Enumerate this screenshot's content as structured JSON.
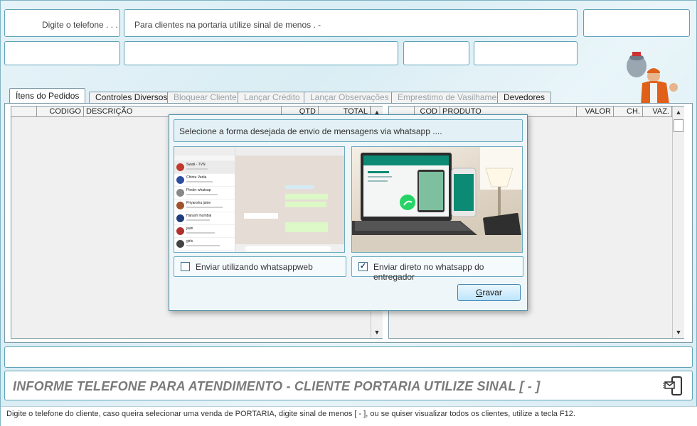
{
  "top_fields": {
    "phone_placeholder": "Digite o telefone . . .",
    "portaria_hint": "Para clientes na portaria utilize sinal de menos  . -"
  },
  "tabs": [
    {
      "label": "Ítens do Pedidos",
      "state": "active"
    },
    {
      "label": "Controles Diversos",
      "state": "enabled"
    },
    {
      "label": "Bloquear Cliente",
      "state": "disabled"
    },
    {
      "label": "Lançar Crédito",
      "state": "disabled"
    },
    {
      "label": "Lançar Observações",
      "state": "disabled"
    },
    {
      "label": "Emprestimo de Vasilhames",
      "state": "disabled"
    },
    {
      "label": "Devedores",
      "state": "enabled"
    }
  ],
  "left_grid": {
    "columns": [
      "",
      "CODIGO",
      "DESCRIÇÃO",
      "QTD",
      "TOTAL"
    ]
  },
  "right_grid": {
    "columns": [
      "",
      "COD",
      "PRODUTO",
      "VALOR",
      "CH.",
      "VAZ."
    ]
  },
  "dialog": {
    "message": "Selecione a forma desejada de envio de mensagens via whatsapp ....",
    "options": [
      {
        "label": "Enviar utilizando whatsappweb",
        "checked": false
      },
      {
        "label": "Enviar direto no whatsapp do entregador",
        "checked": true
      }
    ],
    "save_button": "Gravar",
    "wa_web_chats": [
      {
        "name": "Swati - TVN",
        "color": "#c0392b"
      },
      {
        "name": "Chintu Vedia",
        "color": "#2d4ea0"
      },
      {
        "name": "Pinder whatsap",
        "color": "#888888"
      },
      {
        "name": "Priyanshu jaine",
        "color": "#a0522d"
      },
      {
        "name": "Harash mumbai",
        "color": "#1f3c7a"
      },
      {
        "name": "jaan",
        "color": "#b03030"
      },
      {
        "name": "girls",
        "color": "#444444"
      }
    ]
  },
  "banner": {
    "text": "INFORME TELEFONE PARA ATENDIMENTO - CLIENTE PORTARIA UTILIZE SINAL  [ - ]"
  },
  "status_bar": {
    "text": "Digite o telefone do cliente, caso queira selecionar uma venda de PORTARIA, digite sinal de menos [ - ], ou se quiser visualizar todos os clientes, utilize a tecla F12."
  },
  "colors": {
    "accent_border": "#5ea3b8",
    "whatsapp_green": "#25d366",
    "button_bg": "#bee6fd"
  }
}
